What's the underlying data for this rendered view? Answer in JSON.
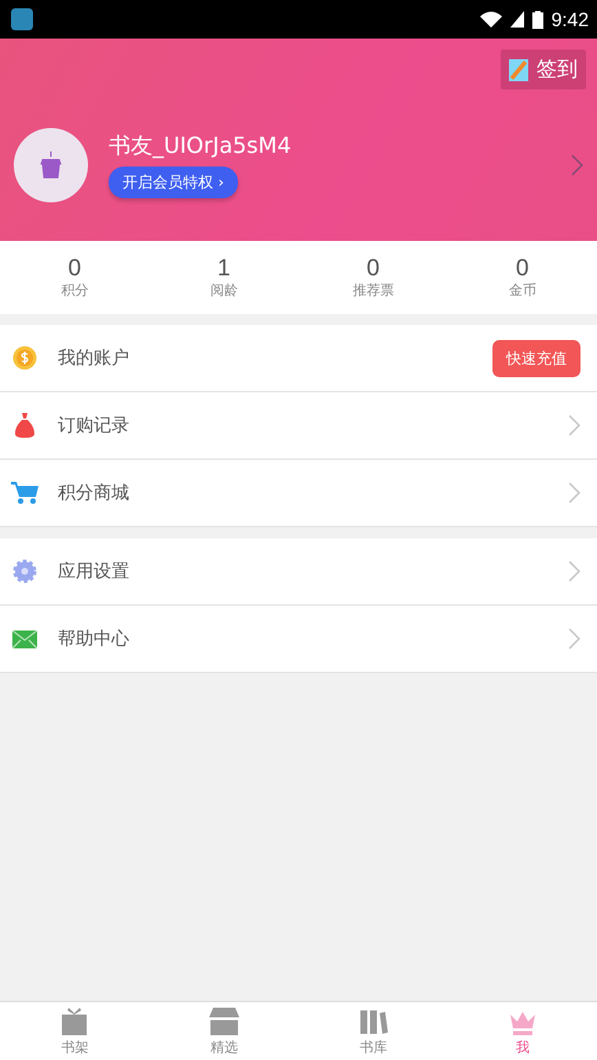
{
  "status_bar": {
    "time": "9:42"
  },
  "profile": {
    "checkin": "签到",
    "username": "书友_UIOrJa5sM4",
    "vip_button": "开启会员特权 ›"
  },
  "stats": [
    {
      "value": "0",
      "label": "积分"
    },
    {
      "value": "1",
      "label": "阅龄"
    },
    {
      "value": "0",
      "label": "推荐票"
    },
    {
      "value": "0",
      "label": "金币"
    }
  ],
  "menu_groups": [
    [
      {
        "label": "我的账户",
        "kind": "button",
        "action": "快速充值"
      },
      {
        "label": "订购记录",
        "kind": "chevron"
      },
      {
        "label": "积分商城",
        "kind": "chevron"
      }
    ],
    [
      {
        "label": "应用设置",
        "kind": "chevron"
      },
      {
        "label": "帮助中心",
        "kind": "chevron"
      }
    ]
  ],
  "tabs": [
    {
      "label": "书架",
      "selected": false
    },
    {
      "label": "精选",
      "selected": false
    },
    {
      "label": "书库",
      "selected": false
    },
    {
      "label": "我",
      "selected": true
    }
  ]
}
